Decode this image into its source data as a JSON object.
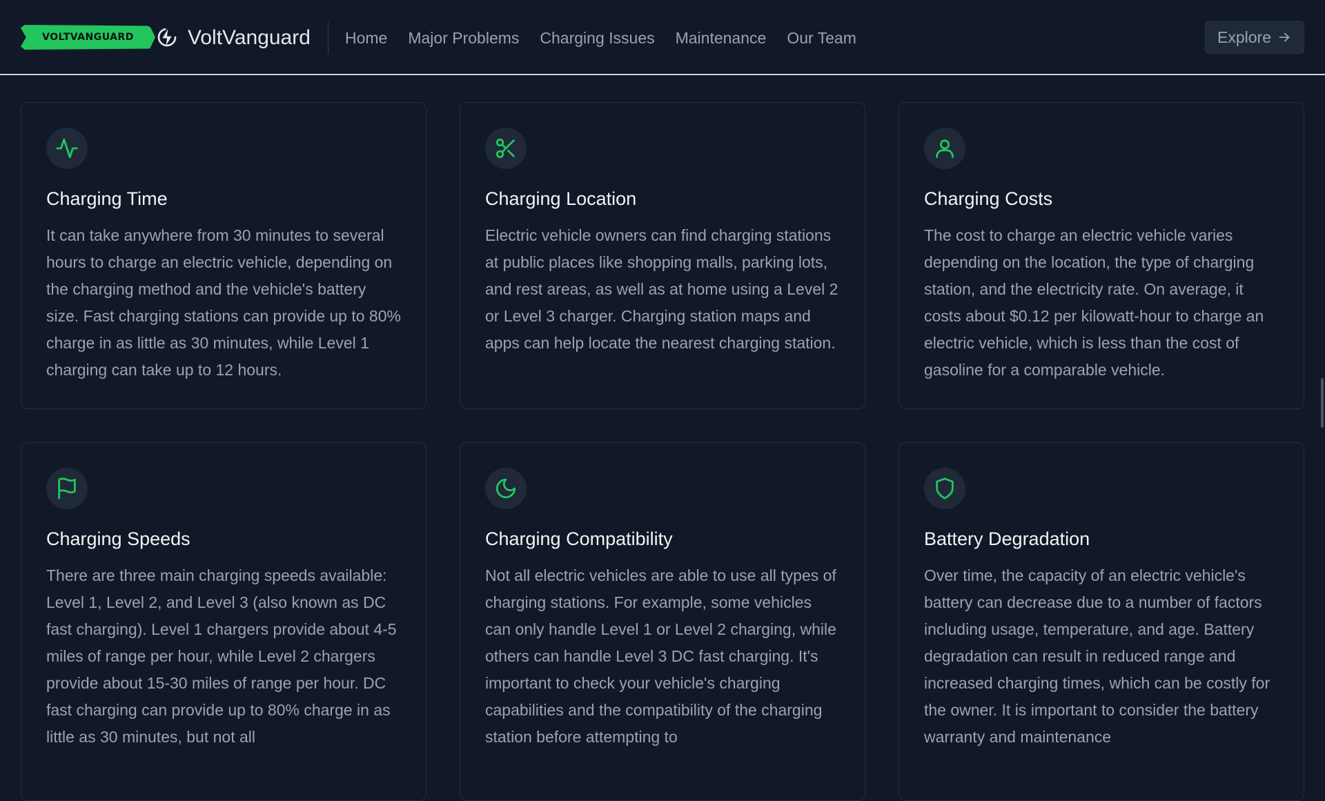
{
  "header": {
    "logo_badge_text": "VOLTVANGUARD",
    "brand_name": "VoltVanguard",
    "nav": [
      "Home",
      "Major Problems",
      "Charging Issues",
      "Maintenance",
      "Our Team"
    ],
    "explore_label": "Explore"
  },
  "colors": {
    "accent": "#22c55e",
    "background": "#111827",
    "card_border": "#263041",
    "muted_text": "#9ca3af"
  },
  "cards": [
    {
      "icon": "activity-icon",
      "title": "Charging Time",
      "body": "It can take anywhere from 30 minutes to several hours to charge an electric vehicle, depending on the charging method and the vehicle's battery size. Fast charging stations can provide up to 80% charge in as little as 30 minutes, while Level 1 charging can take up to 12 hours."
    },
    {
      "icon": "scissors-icon",
      "title": "Charging Location",
      "body": "Electric vehicle owners can find charging stations at public places like shopping malls, parking lots, and rest areas, as well as at home using a Level 2 or Level 3 charger. Charging station maps and apps can help locate the nearest charging station."
    },
    {
      "icon": "user-icon",
      "title": "Charging Costs",
      "body": "The cost to charge an electric vehicle varies depending on the location, the type of charging station, and the electricity rate. On average, it costs about $0.12 per kilowatt-hour to charge an electric vehicle, which is less than the cost of gasoline for a comparable vehicle."
    },
    {
      "icon": "flag-icon",
      "title": "Charging Speeds",
      "body": "There are three main charging speeds available: Level 1, Level 2, and Level 3 (also known as DC fast charging). Level 1 chargers provide about 4-5 miles of range per hour, while Level 2 chargers provide about 15-30 miles of range per hour. DC fast charging can provide up to 80% charge in as little as 30 minutes, but not all"
    },
    {
      "icon": "moon-icon",
      "title": "Charging Compatibility",
      "body": "Not all electric vehicles are able to use all types of charging stations. For example, some vehicles can only handle Level 1 or Level 2 charging, while others can handle Level 3 DC fast charging. It's important to check your vehicle's charging capabilities and the compatibility of the charging station before attempting to"
    },
    {
      "icon": "shield-icon",
      "title": "Battery Degradation",
      "body": "Over time, the capacity of an electric vehicle's battery can decrease due to a number of factors including usage, temperature, and age. Battery degradation can result in reduced range and increased charging times, which can be costly for the owner. It is important to consider the battery warranty and maintenance"
    }
  ]
}
